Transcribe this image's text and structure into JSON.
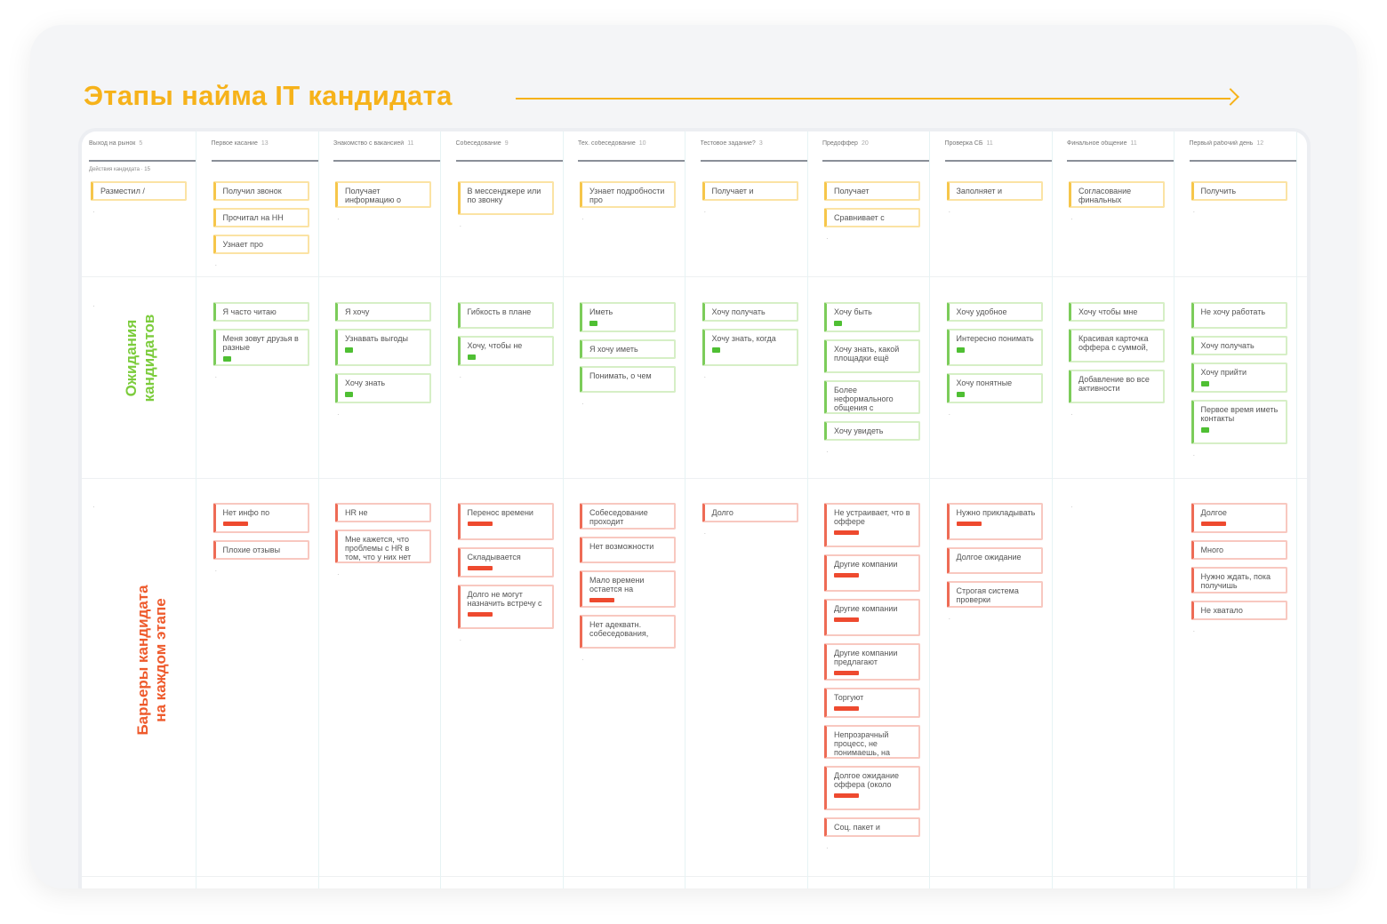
{
  "title": "Этапы найма IT кандидата",
  "labels": {
    "expectations_line1": "Ожидания",
    "expectations_line2": "кандидатов",
    "barriers_line1": "Барьеры кандидата",
    "barriers_line2": "на каждом этапе"
  },
  "colors": {
    "title": "#f6b21a",
    "expectations": "#7ccc3c",
    "barriers": "#ee5a2c"
  },
  "columns": [
    {
      "name": "Выход на рынок",
      "count": "5",
      "sub": "Действия кандидата · 15",
      "actions": [
        "Разместил /"
      ],
      "expectations": [],
      "barriers": []
    },
    {
      "name": "Первое касание",
      "count": "13",
      "sub": "",
      "actions": [
        "Получил звонок",
        "Прочитал на HH",
        "Узнает про"
      ],
      "expectations": [
        {
          "text": "Я часто читаю",
          "tag": false
        },
        {
          "text": "Меня зовут друзья в разные",
          "tag": true
        }
      ],
      "barriers": [
        {
          "text": "Нет инфо по",
          "tag": true
        },
        {
          "text": "Плохие отзывы",
          "tag": false
        }
      ]
    },
    {
      "name": "Знакомство с вакансией",
      "count": "11",
      "sub": "",
      "actions": [
        "Получает информацию о"
      ],
      "expectations": [
        {
          "text": "Я хочу",
          "tag": false
        },
        {
          "text": "Узнавать выгоды",
          "tag": true
        },
        {
          "text": "Хочу знать",
          "tag": true
        }
      ],
      "barriers": [
        {
          "text": "HR не",
          "tag": false
        },
        {
          "text": "Мне кажется, что проблемы с HR в том, что у них нет",
          "tag": false
        }
      ]
    },
    {
      "name": "Собеседование",
      "count": "9",
      "sub": "",
      "actions": [
        "В мессенджере или по звонку"
      ],
      "expectations": [
        {
          "text": "Гибкость в плане",
          "tag": false
        },
        {
          "text": "Хочу, чтобы не",
          "tag": true
        }
      ],
      "barriers": [
        {
          "text": "Перенос времени",
          "tag": true
        },
        {
          "text": "Складывается",
          "tag": true
        },
        {
          "text": "Долго не могут назначить встречу с",
          "tag": true
        }
      ]
    },
    {
      "name": "Тех. собеседование",
      "count": "10",
      "sub": "",
      "actions": [
        "Узнает подробности про"
      ],
      "expectations": [
        {
          "text": "Иметь",
          "tag": true
        },
        {
          "text": "Я хочу иметь",
          "tag": false
        },
        {
          "text": "Понимать, о чем",
          "tag": false
        }
      ],
      "barriers": [
        {
          "text": "Собеседование проходит",
          "tag": false
        },
        {
          "text": "Нет возможности",
          "tag": false
        },
        {
          "text": "Мало времени остается на",
          "tag": true
        },
        {
          "text": "Нет адекватн. собеседования,",
          "tag": false
        }
      ]
    },
    {
      "name": "Тестовое задание?",
      "count": "3",
      "sub": "",
      "actions": [
        "Получает и"
      ],
      "expectations": [
        {
          "text": "Хочу получать",
          "tag": false
        },
        {
          "text": "Хочу знать, когда",
          "tag": true
        }
      ],
      "barriers": [
        {
          "text": "Долго",
          "tag": false
        }
      ]
    },
    {
      "name": "Предоффер",
      "count": "20",
      "sub": "",
      "actions": [
        "Получает",
        "Сравнивает с"
      ],
      "expectations": [
        {
          "text": "Хочу быть",
          "tag": true
        },
        {
          "text": "Хочу знать, какой площадки ещё",
          "tag": false
        },
        {
          "text": "Более неформального общения с",
          "tag": false
        },
        {
          "text": "Хочу увидеть",
          "tag": false
        }
      ],
      "barriers": [
        {
          "text": "Не устраивает, что в оффере",
          "tag": true
        },
        {
          "text": "Другие компании",
          "tag": true
        },
        {
          "text": "Другие компании",
          "tag": true
        },
        {
          "text": "Другие компании предлагают",
          "tag": true
        },
        {
          "text": "Торгуют",
          "tag": true
        },
        {
          "text": "Непрозрачный процесс, не понимаешь, на",
          "tag": false
        },
        {
          "text": "Долгое ожидание оффера (около",
          "tag": true
        },
        {
          "text": "Соц. пакет и",
          "tag": false
        }
      ]
    },
    {
      "name": "Проверка СБ",
      "count": "11",
      "sub": "",
      "actions": [
        "Заполняет и"
      ],
      "expectations": [
        {
          "text": "Хочу удобное",
          "tag": false
        },
        {
          "text": "Интересно понимать",
          "tag": true
        },
        {
          "text": "Хочу понятные",
          "tag": true
        }
      ],
      "barriers": [
        {
          "text": "Нужно прикладывать",
          "tag": true
        },
        {
          "text": "Долгое ожидание",
          "tag": false
        },
        {
          "text": "Строгая система проверки",
          "tag": false
        }
      ]
    },
    {
      "name": "Финальное общение",
      "count": "11",
      "sub": "",
      "actions": [
        "Согласование финальных"
      ],
      "expectations": [
        {
          "text": "Хочу чтобы мне",
          "tag": false
        },
        {
          "text": "Красивая карточка оффера с суммой,",
          "tag": false
        },
        {
          "text": "Добавление во все активности",
          "tag": false
        }
      ],
      "barriers": []
    },
    {
      "name": "Первый рабочий день",
      "count": "12",
      "sub": "",
      "actions": [
        "Получить"
      ],
      "expectations": [
        {
          "text": "Не хочу работать",
          "tag": false
        },
        {
          "text": "Хочу получать",
          "tag": false
        },
        {
          "text": "Хочу прийти",
          "tag": true
        },
        {
          "text": "Первое время иметь контакты",
          "tag": true
        }
      ],
      "barriers": [
        {
          "text": "Долгое",
          "tag": true
        },
        {
          "text": "Много",
          "tag": false
        },
        {
          "text": "Нужно ждать, пока получишь",
          "tag": false
        },
        {
          "text": "Не хватало",
          "tag": false
        }
      ]
    }
  ]
}
